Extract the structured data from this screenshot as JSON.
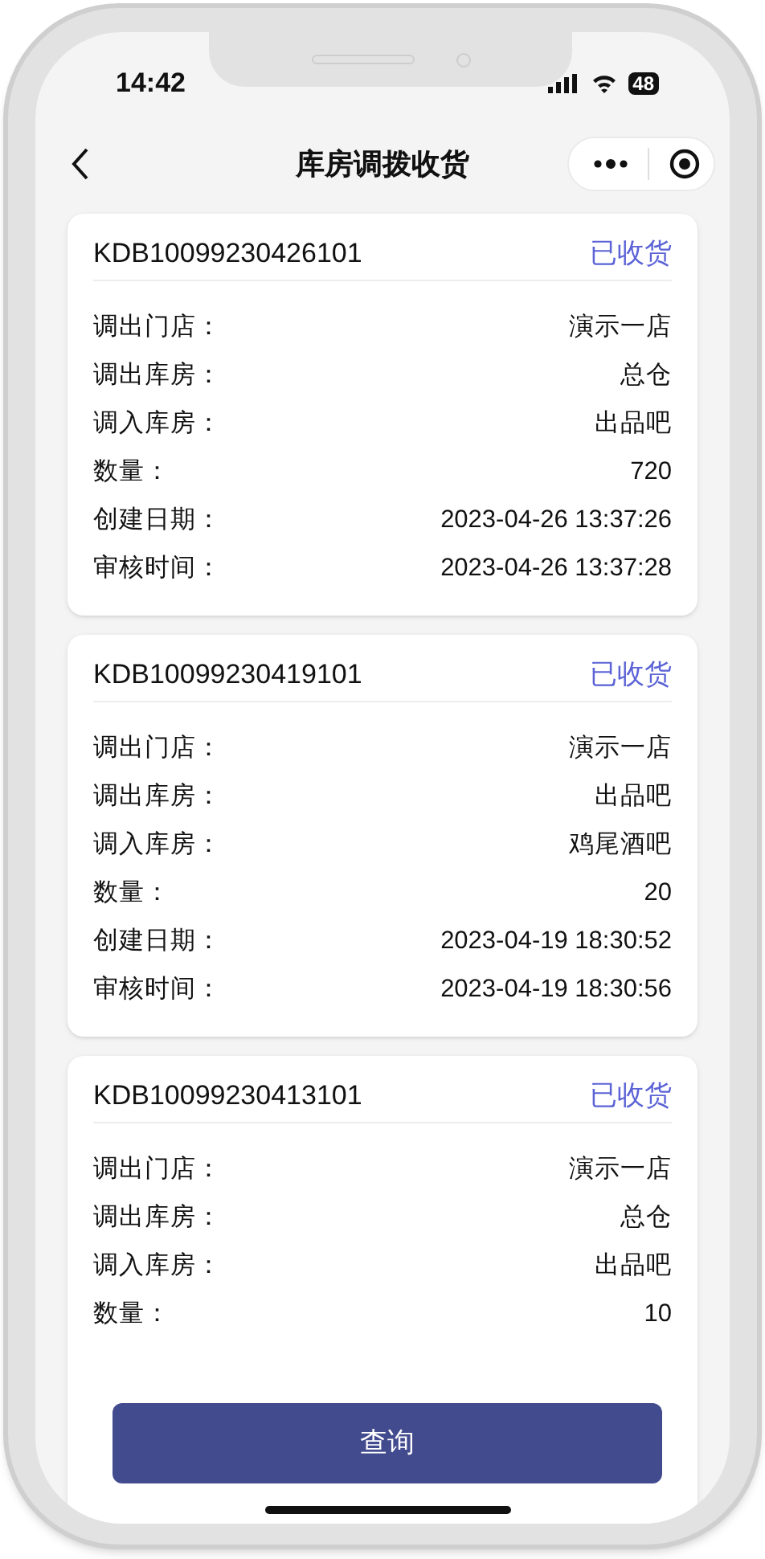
{
  "status_bar": {
    "time": "14:42",
    "battery": "48"
  },
  "nav": {
    "title": "库房调拨收货"
  },
  "records": [
    {
      "id": "KDB10099230426101",
      "status": "已收货",
      "fields": [
        {
          "label": "调出门店：",
          "value": "演示一店"
        },
        {
          "label": "调出库房：",
          "value": "总仓"
        },
        {
          "label": "调入库房：",
          "value": "出品吧"
        },
        {
          "label": "数量：",
          "value": "720"
        },
        {
          "label": "创建日期：",
          "value": "2023-04-26 13:37:26"
        },
        {
          "label": "审核时间：",
          "value": "2023-04-26 13:37:28"
        }
      ]
    },
    {
      "id": "KDB10099230419101",
      "status": "已收货",
      "fields": [
        {
          "label": "调出门店：",
          "value": "演示一店"
        },
        {
          "label": "调出库房：",
          "value": "出品吧"
        },
        {
          "label": "调入库房：",
          "value": "鸡尾酒吧"
        },
        {
          "label": "数量：",
          "value": "20"
        },
        {
          "label": "创建日期：",
          "value": "2023-04-19 18:30:52"
        },
        {
          "label": "审核时间：",
          "value": "2023-04-19 18:30:56"
        }
      ]
    },
    {
      "id": "KDB10099230413101",
      "status": "已收货",
      "fields": [
        {
          "label": "调出门店：",
          "value": "演示一店"
        },
        {
          "label": "调出库房：",
          "value": "总仓"
        },
        {
          "label": "调入库房：",
          "value": "出品吧"
        },
        {
          "label": "数量：",
          "value": "10"
        }
      ]
    }
  ],
  "query_button": "查询"
}
